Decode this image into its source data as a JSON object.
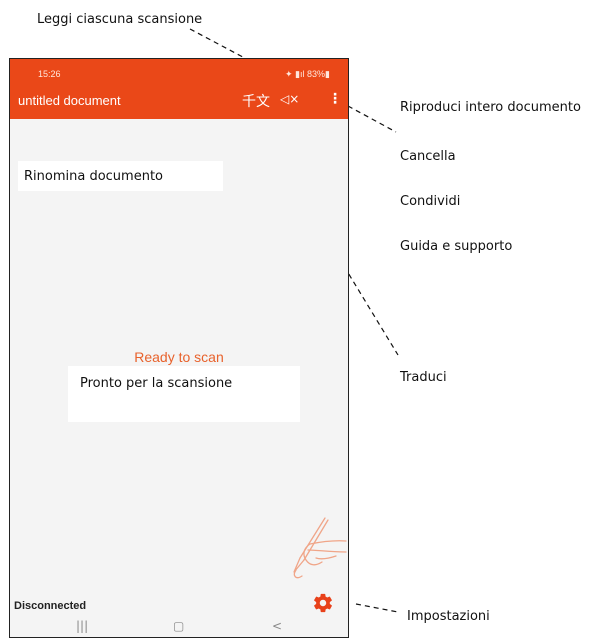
{
  "callouts": {
    "read_each_scan": "Leggi ciascuna scansione",
    "play_whole_document": "Riproduci intero documento",
    "delete": "Cancella",
    "share": "Condividi",
    "help_support": "Guida e supporto",
    "translate": "Traduci",
    "settings": "Impostazioni",
    "rename_document": "Rinomina documento",
    "ready_to_scan": "Pronto per la scansione"
  },
  "phone": {
    "status": {
      "time": "15:26",
      "indicators": "✦ ▮ıl 83%▮"
    },
    "app_bar": {
      "title": "untitled document",
      "translate_icon_glyph": "千文",
      "speaker_icon_glyph": "◁×",
      "menu_icon_glyph": "⋮",
      "color": "#ea4818"
    },
    "main": {
      "status_text": "Ready to scan",
      "status_color": "#e8622c"
    },
    "bottom": {
      "connection": "Disconnected"
    },
    "nav": {
      "recents": "|||",
      "home": "▢",
      "back": "<"
    },
    "icons": [
      "translate-icon",
      "mute-speaker-icon",
      "more-vert-icon",
      "hand-pen-icon",
      "gear-icon"
    ]
  }
}
